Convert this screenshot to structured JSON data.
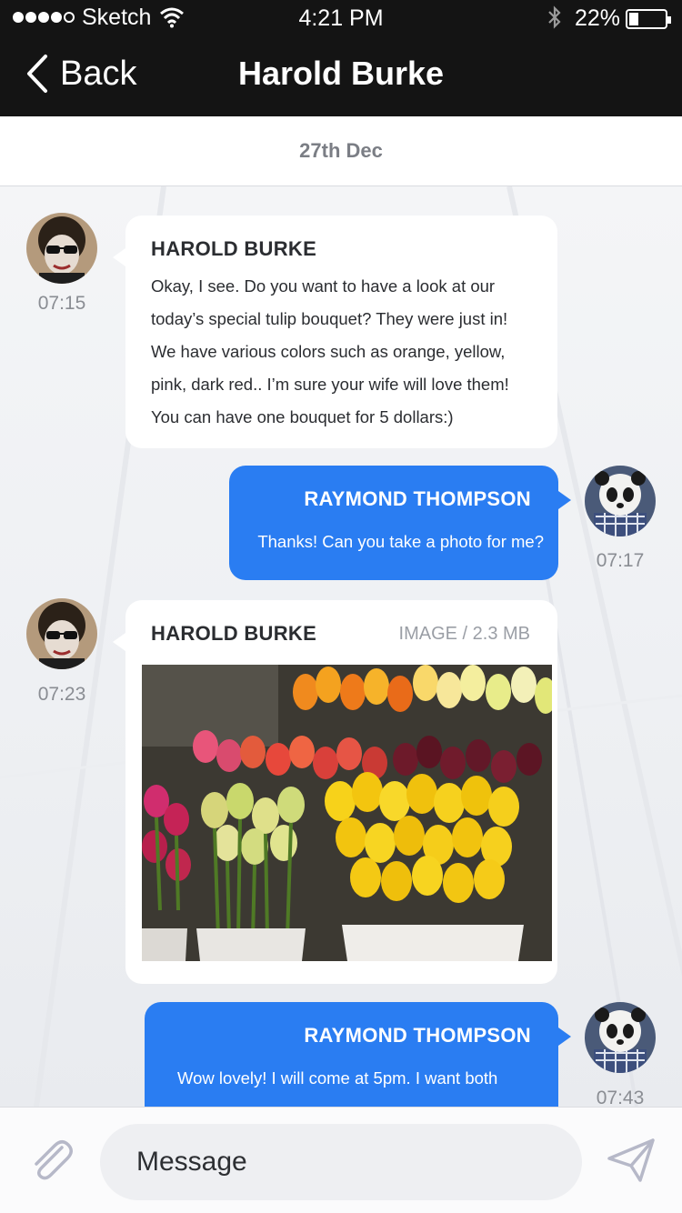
{
  "status_bar": {
    "carrier": "Sketch",
    "time": "4:21 PM",
    "battery_percent": "22%",
    "battery_level": 0.22,
    "signal_bars_filled": 4,
    "signal_bars_total": 5
  },
  "nav": {
    "back_label": "Back",
    "title": "Harold Burke"
  },
  "date_label": "27th Dec",
  "messages": [
    {
      "direction": "incoming",
      "sender": "HAROLD BURKE",
      "time": "07:15",
      "lines": [
        "Okay, I see. Do you want to have a look at our",
        "today’s special tulip bouquet? They were just in!",
        "We have various colors such as orange, yellow,",
        "pink, dark red.. I’m sure your wife will love them!",
        "You can have one bouquet for 5 dollars:)"
      ]
    },
    {
      "direction": "outgoing",
      "sender": "RAYMOND THOMPSON",
      "time": "07:17",
      "lines": [
        "Thanks! Can you take a photo for me?"
      ]
    },
    {
      "direction": "incoming",
      "sender": "HAROLD BURKE",
      "time": "07:23",
      "attachment_meta": "IMAGE / 2.3 MB",
      "attachment_type": "image"
    },
    {
      "direction": "outgoing",
      "sender": "RAYMOND THOMPSON",
      "time": "07:43",
      "lines": [
        "Wow lovely! I will come at 5pm. I want both"
      ]
    }
  ],
  "composer": {
    "placeholder": "Message"
  },
  "colors": {
    "header_bg": "#141414",
    "outgoing_bubble": "#2a7df2",
    "incoming_bubble": "#ffffff",
    "timestamp": "#8a8d93"
  }
}
